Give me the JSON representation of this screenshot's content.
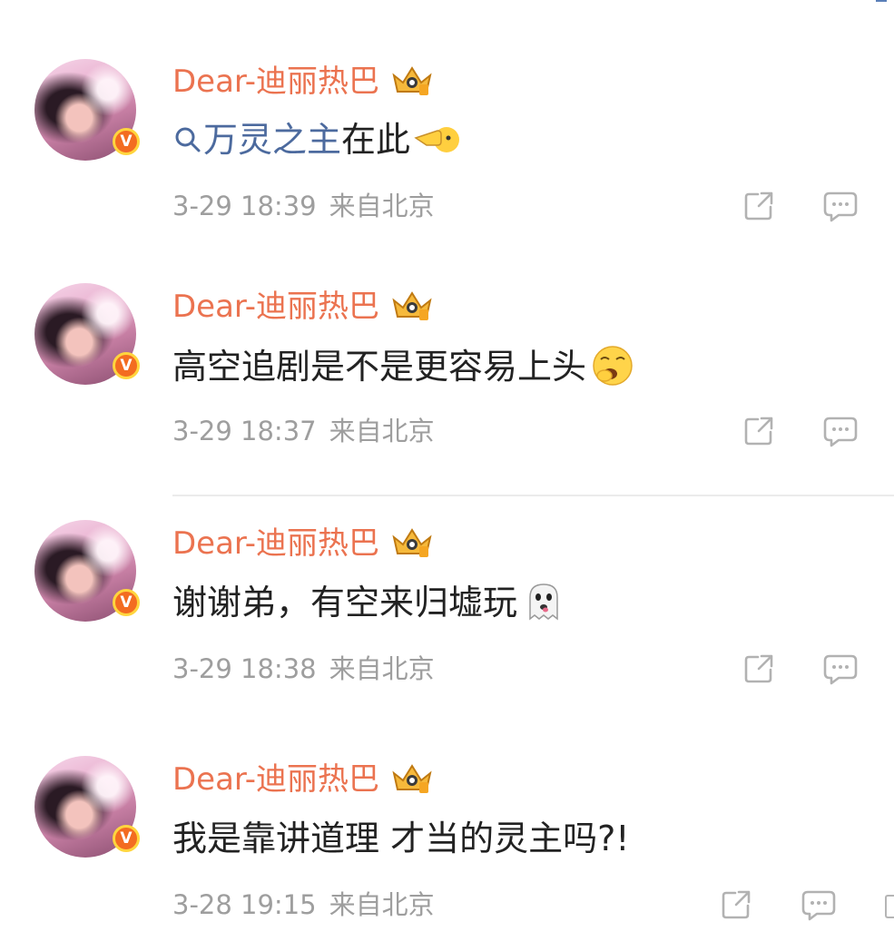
{
  "comments": [
    {
      "username": "Dear-迪丽热巴",
      "topic_label": "万灵之主",
      "text": "在此",
      "emoji": "pointing-hand-emoji",
      "time": "3-29 18:39",
      "source": "来自北京"
    },
    {
      "username": "Dear-迪丽热巴",
      "text": "高空追剧是不是更容易上头",
      "emoji": "yawning-face-emoji",
      "time": "3-29 18:37",
      "source": "来自北京"
    },
    {
      "username": "Dear-迪丽热巴",
      "text": "谢谢弟，有空来归墟玩",
      "emoji": "ghost-emoji",
      "time": "3-29 18:38",
      "source": "来自北京"
    },
    {
      "username": "Dear-迪丽热巴",
      "text": "我是靠讲道理 才当的灵主吗?!",
      "time": "3-28 19:15",
      "source": "来自北京"
    }
  ],
  "verified_badge": "V",
  "colors": {
    "username": "#eb7350",
    "topic": "#4c6a9e",
    "meta": "#9e9e9e",
    "verified": "#f36c21",
    "icon": "#b2b2b2"
  },
  "icons": {
    "share": "share-icon",
    "reply": "comment-icon",
    "vip": "crown-vip-icon",
    "search": "search-icon"
  }
}
